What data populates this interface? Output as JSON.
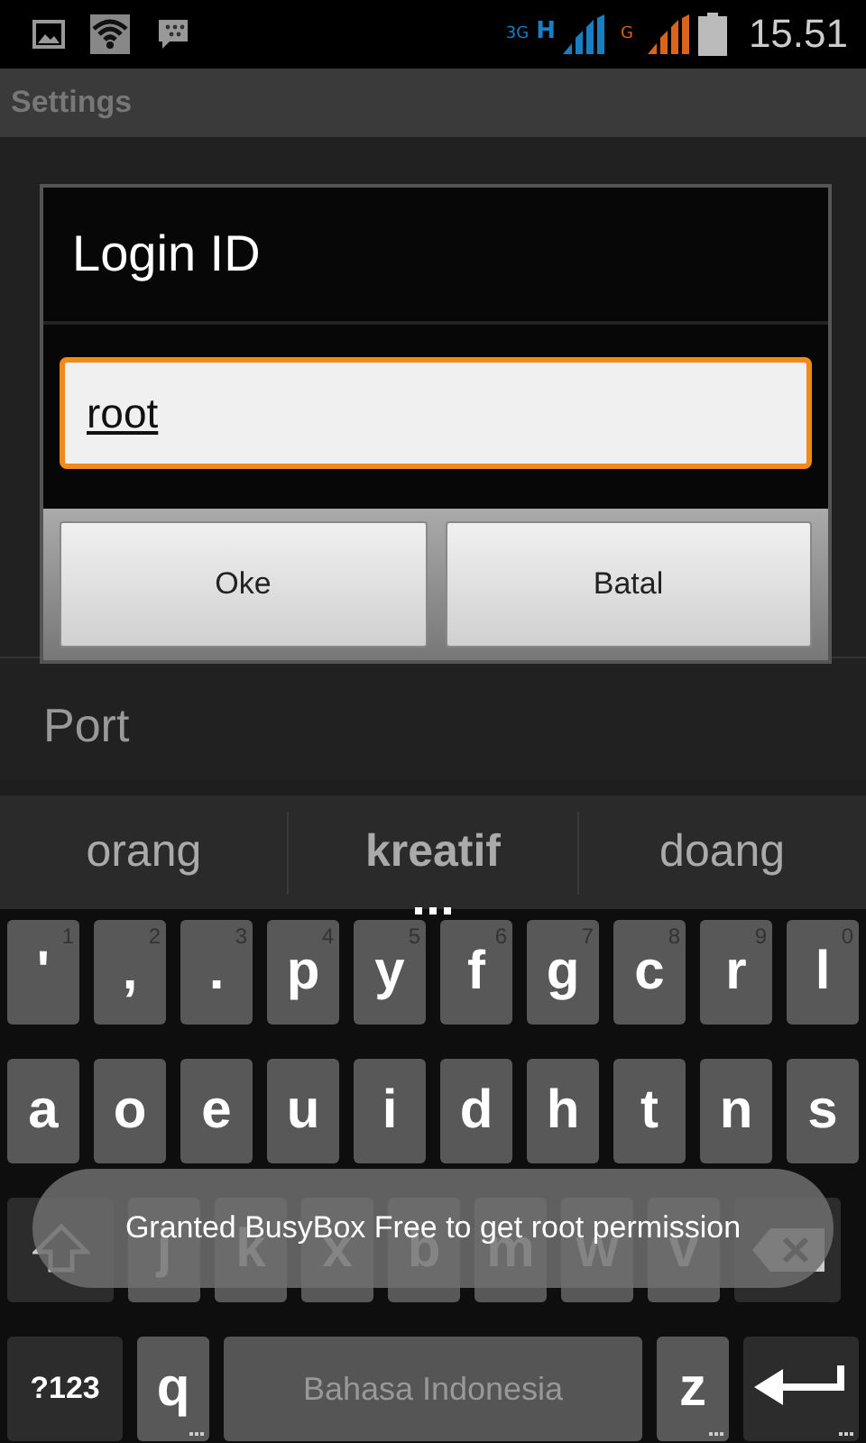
{
  "status_bar": {
    "time": "15.51",
    "network_3g": "3G",
    "network_h": "H",
    "network_g": "G"
  },
  "action_bar": {
    "title": "Settings"
  },
  "settings": [
    {
      "title": "Port"
    }
  ],
  "dialog": {
    "title": "Login ID",
    "value": "root",
    "buttons": [
      "Oke",
      "Batal"
    ]
  },
  "keyboard": {
    "suggestions": [
      {
        "text": "orang",
        "selected": false
      },
      {
        "text": "kreatif",
        "selected": true
      },
      {
        "text": "doang",
        "selected": false
      }
    ],
    "rows": [
      {
        "keys": [
          {
            "kind": "char",
            "label": "'",
            "hint": "1"
          },
          {
            "kind": "char",
            "label": ",",
            "hint": "2"
          },
          {
            "kind": "char",
            "label": ".",
            "hint": "3"
          },
          {
            "kind": "char",
            "label": "p",
            "hint": "4"
          },
          {
            "kind": "char",
            "label": "y",
            "hint": "5"
          },
          {
            "kind": "char",
            "label": "f",
            "hint": "6"
          },
          {
            "kind": "char",
            "label": "g",
            "hint": "7"
          },
          {
            "kind": "char",
            "label": "c",
            "hint": "8"
          },
          {
            "kind": "char",
            "label": "r",
            "hint": "9"
          },
          {
            "kind": "char",
            "label": "l",
            "hint": "0"
          }
        ]
      },
      {
        "keys": [
          {
            "kind": "char",
            "label": "a"
          },
          {
            "kind": "char",
            "label": "o"
          },
          {
            "kind": "char",
            "label": "e"
          },
          {
            "kind": "char",
            "label": "u"
          },
          {
            "kind": "char",
            "label": "i"
          },
          {
            "kind": "char",
            "label": "d"
          },
          {
            "kind": "char",
            "label": "h"
          },
          {
            "kind": "char",
            "label": "t"
          },
          {
            "kind": "char",
            "label": "n"
          },
          {
            "kind": "char",
            "label": "s"
          }
        ]
      },
      {
        "keys": [
          {
            "kind": "shift"
          },
          {
            "kind": "char",
            "label": "j"
          },
          {
            "kind": "char",
            "label": "k"
          },
          {
            "kind": "char",
            "label": "x"
          },
          {
            "kind": "char",
            "label": "b"
          },
          {
            "kind": "char",
            "label": "m"
          },
          {
            "kind": "char",
            "label": "w"
          },
          {
            "kind": "char",
            "label": "v"
          },
          {
            "kind": "delete"
          }
        ]
      },
      {
        "keys": [
          {
            "kind": "mode",
            "label": "?123"
          },
          {
            "kind": "char",
            "label": "q",
            "more": true
          },
          {
            "kind": "space",
            "label": "Bahasa Indonesia"
          },
          {
            "kind": "char",
            "label": "z",
            "more": true
          },
          {
            "kind": "enter",
            "more": true
          }
        ]
      }
    ]
  },
  "toast": {
    "text": "Granted BusyBox Free to get root permission"
  }
}
